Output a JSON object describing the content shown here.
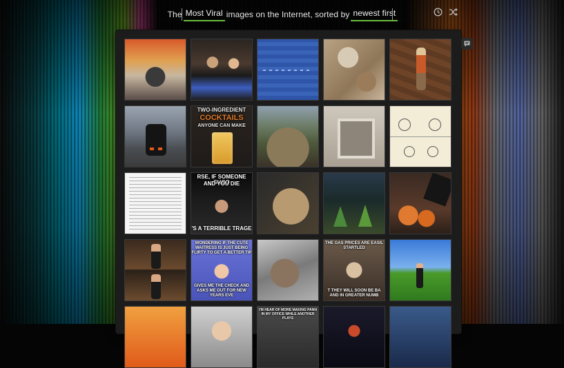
{
  "header": {
    "prefix": "The",
    "filter": "Most Viral",
    "middle": "images on the Internet, sorted by",
    "sort": "newest first",
    "history_icon": "clock-icon",
    "shuffle_icon": "shuffle-icon"
  },
  "chat_icon": "chat-bubble-icon",
  "thumbnails": [
    {
      "name": "thumb-comic-motorcycle",
      "top": "",
      "bottom": ""
    },
    {
      "name": "thumb-bar-couple",
      "top": "",
      "bottom": ""
    },
    {
      "name": "thumb-blue-fabric",
      "top": "",
      "bottom": ""
    },
    {
      "name": "thumb-floor-debris",
      "top": "",
      "bottom": ""
    },
    {
      "name": "thumb-action-figure",
      "top": "",
      "bottom": ""
    },
    {
      "name": "thumb-motorcycle-street",
      "top": "",
      "bottom": ""
    },
    {
      "name": "thumb-cocktails",
      "top": "TWO-INGREDIENT",
      "mid": "COCKTAILS",
      "bottom": "ANYONE CAN MAKE"
    },
    {
      "name": "thumb-fisheye-yard",
      "top": "",
      "bottom": ""
    },
    {
      "name": "thumb-concrete-box",
      "top": "",
      "bottom": ""
    },
    {
      "name": "thumb-sketch-comic",
      "top": "",
      "bottom": ""
    },
    {
      "name": "thumb-text-document",
      "top": "",
      "bottom": ""
    },
    {
      "name": "thumb-meme-comedian",
      "top": "RSE, IF SOMEONE SHOO",
      "mid": "AND YOU DIE",
      "bottom": "'S A TERRIBLE TRAGE"
    },
    {
      "name": "thumb-boot-closeup",
      "top": "",
      "bottom": ""
    },
    {
      "name": "thumb-gnome-meme",
      "top": "",
      "bottom": ""
    },
    {
      "name": "thumb-hand-orange",
      "top": "",
      "bottom": ""
    },
    {
      "name": "thumb-talkshow",
      "top": "",
      "bottom": ""
    },
    {
      "name": "thumb-success-kid",
      "top": "WONDERING IF THE CUTE",
      "mid": "WAITRESS IS JUST BEING FLIRTY TO GET A BETTER TIP",
      "bottom": "GIVES ME THE CHECK AND ASKS ME OUT FOR NEW YEARS EVE"
    },
    {
      "name": "thumb-cat-blur",
      "top": "",
      "bottom": ""
    },
    {
      "name": "thumb-obiwan-meme",
      "top": "THE GAS PRICES ARE EASIL",
      "mid": "STARTLED",
      "bottom": "T THEY WILL SOON BE BA AND IN GREATER NUMB"
    },
    {
      "name": "thumb-windows-xp",
      "top": "",
      "bottom": ""
    },
    {
      "name": "thumb-orange-cartoon",
      "top": "",
      "bottom": ""
    },
    {
      "name": "thumb-person-portrait",
      "top": "",
      "bottom": ""
    },
    {
      "name": "thumb-text-meme",
      "top": "I'M HEAR OF MORE MAKING PANN IN MY OFFICE WHILE ANOTHER PLAYS",
      "mid": "",
      "bottom": ""
    },
    {
      "name": "thumb-dark-scene",
      "top": "",
      "bottom": ""
    },
    {
      "name": "thumb-anime-art",
      "top": "",
      "bottom": ""
    }
  ]
}
